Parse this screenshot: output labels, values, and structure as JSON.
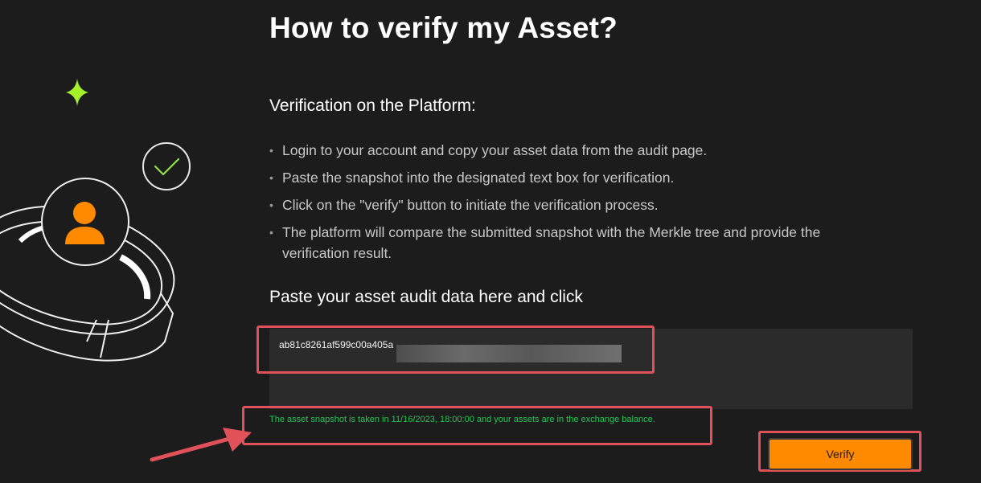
{
  "page": {
    "title": "How to verify my Asset?",
    "section_title": "Verification on the Platform:",
    "steps": [
      "Login to your account and copy your asset data from the audit page.",
      "Paste the snapshot into the designated text box for verification.",
      "Click on the \"verify\" button to initiate the verification process.",
      "The platform will compare the submitted snapshot with the Merkle tree and provide the verification result."
    ],
    "bullet": "•",
    "paste_title": "Paste your asset audit data here and click"
  },
  "textbox": {
    "value": "ab81c8261af599c00a405a"
  },
  "snapshot_message": "The asset snapshot is taken in 11/16/2023, 18:00:00 and your assets are in the exchange balance.",
  "verify_button": {
    "label": "Verify"
  },
  "colors": {
    "background": "#1c1c1c",
    "accent": "#ff8a00",
    "success_text": "#27c257",
    "highlight": "#e0515a",
    "sparkle": "#a6f22a"
  },
  "icons": [
    "sparkle-icon",
    "check-circle-icon",
    "user-avatar-icon",
    "ring-illustration",
    "arrow-annotation"
  ]
}
